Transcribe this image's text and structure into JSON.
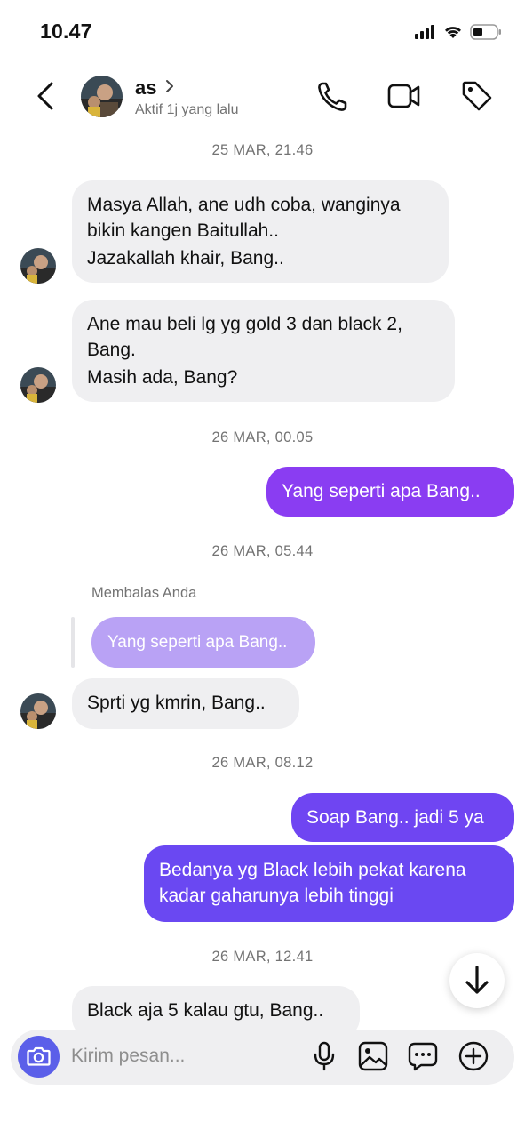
{
  "status_bar": {
    "time": "10.47"
  },
  "header": {
    "name": "as",
    "status": "Aktif 1j yang lalu"
  },
  "messages": {
    "date1": "25 MAR, 21.46",
    "m1": [
      "Masya Allah, ane udh coba, wanginya",
      "bikin kangen Baitullah..",
      "Jazakallah khair, Bang.."
    ],
    "m2": [
      "Ane mau beli lg yg gold 3 dan black 2,",
      "Bang.",
      "Masih ada, Bang?"
    ],
    "date2": "26 MAR, 00.05",
    "m3": "Yang seperti apa Bang..",
    "date3": "26 MAR, 05.44",
    "reply_label": "Membalas Anda",
    "reply_quote": "Yang seperti apa Bang..",
    "m4": "Sprti yg kmrin, Bang..",
    "date4": "26 MAR, 08.12",
    "m5": "Soap Bang.. jadi 5 ya",
    "m6": [
      "Bedanya yg Black lebih pekat karena",
      "kadar gaharunya lebih tinggi"
    ],
    "date5": "26 MAR, 12.41",
    "m7": "Black aja 5 kalau gtu, Bang.."
  },
  "composer": {
    "placeholder": "Kirim pesan..."
  },
  "colors": {
    "out_bubble_1": "#8a3df2",
    "out_bubble_2": "#6c47f2",
    "reply_quote_bg": "#b9a2f5",
    "composer_camera": "#5b5fe9"
  },
  "icons": [
    "back-icon",
    "chevron-right-icon",
    "phone-icon",
    "video-call-icon",
    "tag-icon",
    "camera-icon",
    "microphone-icon",
    "gallery-icon",
    "sticker-icon",
    "plus-icon",
    "arrow-down-icon"
  ]
}
